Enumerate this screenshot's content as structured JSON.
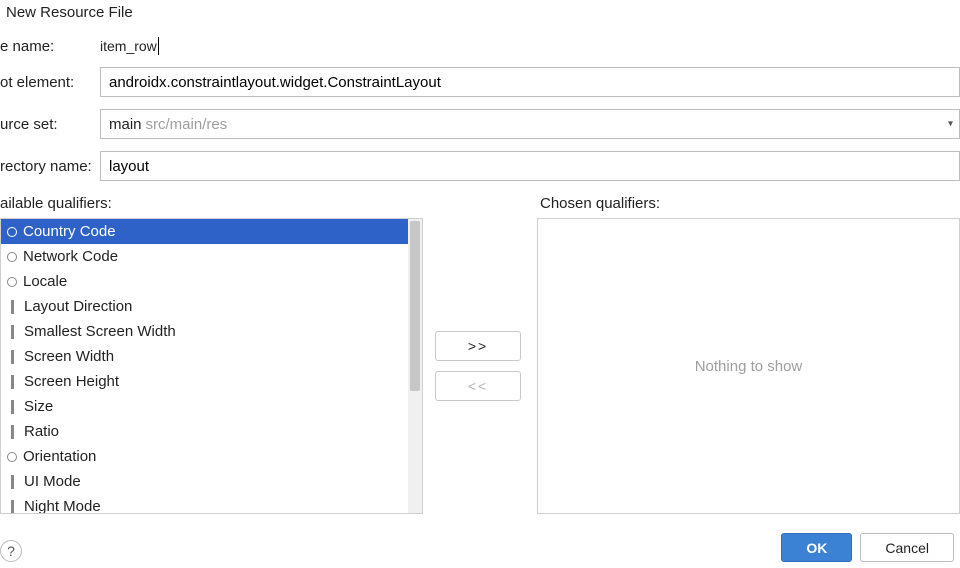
{
  "dialog": {
    "title": "New Resource File"
  },
  "form": {
    "file_name_label": "e name:",
    "file_name_value": "item_row",
    "root_element_label": "ot element:",
    "root_element_value": "androidx.constraintlayout.widget.ConstraintLayout",
    "source_set_label": "urce set:",
    "source_set_value": "main",
    "source_set_hint": "src/main/res",
    "directory_label": "rectory name:",
    "directory_value": "layout"
  },
  "qualifiers": {
    "available_label": "ailable qualifiers:",
    "chosen_label": "Chosen qualifiers:",
    "nothing_text": "Nothing to show",
    "items": [
      {
        "label": "Country Code",
        "selected": true,
        "iconShape": "circle"
      },
      {
        "label": "Network Code",
        "selected": false,
        "iconShape": "circle"
      },
      {
        "label": "Locale",
        "selected": false,
        "iconShape": "circle"
      },
      {
        "label": "Layout Direction",
        "selected": false,
        "iconShape": "bar"
      },
      {
        "label": "Smallest Screen Width",
        "selected": false,
        "iconShape": "bar"
      },
      {
        "label": "Screen Width",
        "selected": false,
        "iconShape": "bar"
      },
      {
        "label": "Screen Height",
        "selected": false,
        "iconShape": "bar"
      },
      {
        "label": "Size",
        "selected": false,
        "iconShape": "bar"
      },
      {
        "label": "Ratio",
        "selected": false,
        "iconShape": "bar"
      },
      {
        "label": "Orientation",
        "selected": false,
        "iconShape": "circle"
      },
      {
        "label": "UI Mode",
        "selected": false,
        "iconShape": "bar"
      },
      {
        "label": "Night Mode",
        "selected": false,
        "iconShape": "bar"
      }
    ]
  },
  "buttons": {
    "add": ">>",
    "remove": "<<",
    "ok": "OK",
    "cancel": "Cancel"
  }
}
